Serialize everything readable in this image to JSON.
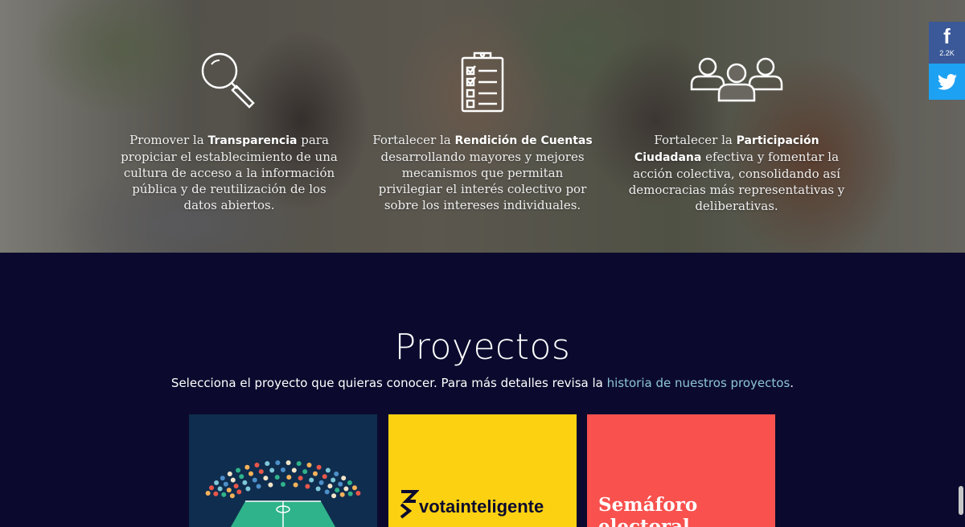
{
  "pillars": [
    {
      "icon": "magnifier-icon",
      "pre": "Promover la ",
      "bold": "Transparencia",
      "post": " para propiciar el establecimiento de una cultura de acceso a la información pública y de reutilización de los datos abiertos."
    },
    {
      "icon": "clipboard-checklist-icon",
      "pre": "Fortalecer la ",
      "bold": "Rendición de Cuentas",
      "post": " desarrollando mayores y mejores mecanismos que permitan privilegiar el interés colectivo por sobre los intereses individuales."
    },
    {
      "icon": "people-group-icon",
      "pre": "Fortalecer la ",
      "bold": "Participación Ciudadana",
      "post": " efectiva y fomentar la acción colectiva, consolidando así democracias más representativas y deliberativas."
    }
  ],
  "social": {
    "facebook_letter": "f",
    "facebook_count": "2.2K",
    "facebook_color": "#3b5998",
    "twitter_color": "#1da1f2"
  },
  "projects": {
    "title": "Proyectos",
    "intro_text": "Selecciona el proyecto que quieras conocer. Para más detalles revisa la ",
    "intro_link": "historia de nuestros proyectos",
    "intro_end": ".",
    "cards": [
      {
        "color": "#0f2d4e",
        "label": ""
      },
      {
        "color": "#fcd112",
        "label": "votainteligente"
      },
      {
        "color": "#f8514e",
        "label": "Semáforo electoral"
      }
    ]
  }
}
